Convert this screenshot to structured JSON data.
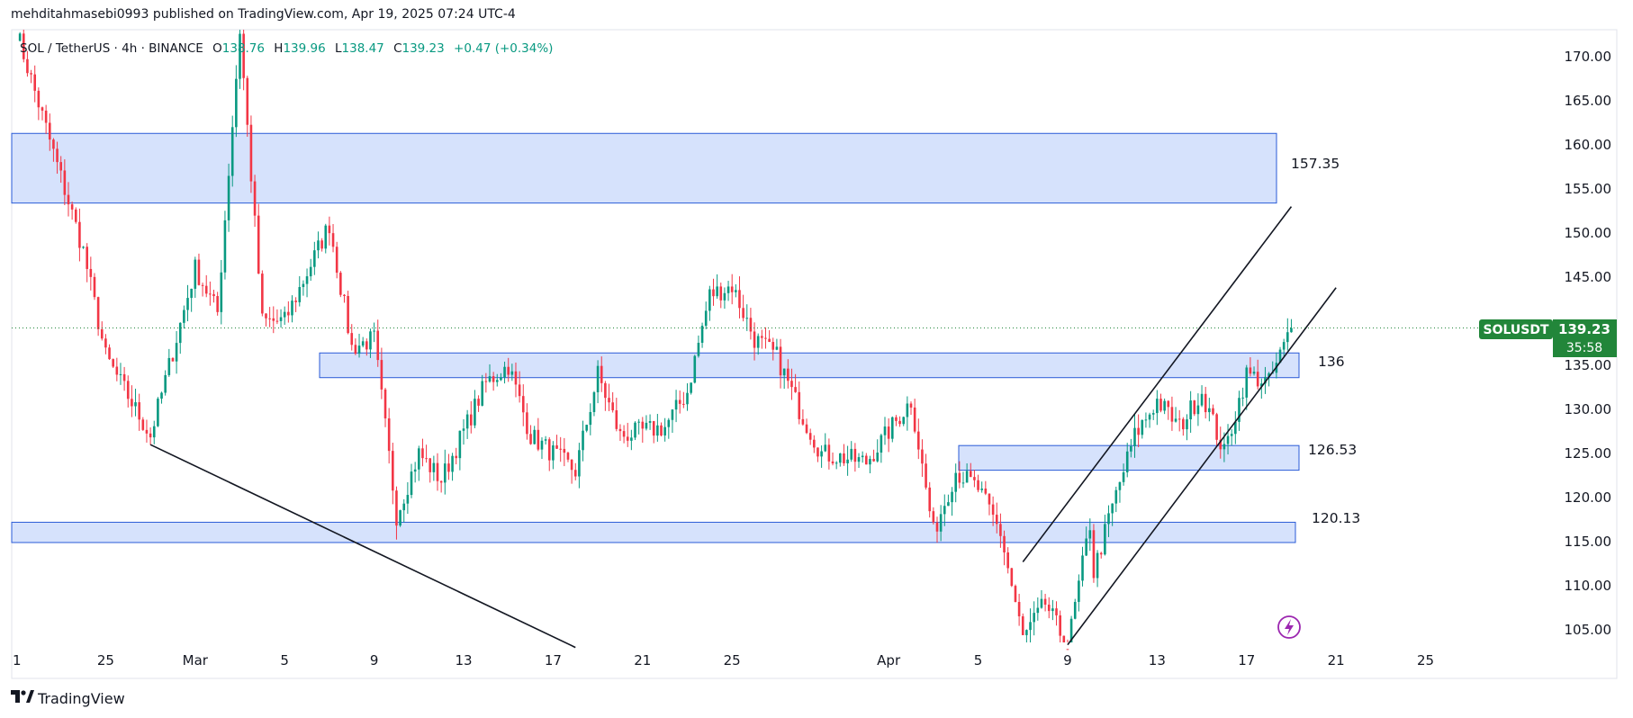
{
  "header": {
    "published_by": "mehditahmasebi0993 published on TradingView.com, Apr 19, 2025 07:24 UTC-4"
  },
  "footer": {
    "brand": "TradingView",
    "logo_icon": "tradingview-logo-icon"
  },
  "legend": {
    "symbol": "SOL / TetherUS · 4h · BINANCE",
    "open_label": "O",
    "open": "138.76",
    "high_label": "H",
    "high": "139.96",
    "low_label": "L",
    "low": "138.47",
    "close_label": "C",
    "close": "139.23",
    "change": "+0.47 (+0.34%)"
  },
  "price_badge": {
    "symbol": "SOLUSDT",
    "price": "139.23",
    "countdown": "35:58",
    "color": "#22863a"
  },
  "colors": {
    "up": "#089981",
    "down": "#f23645",
    "zone_fill": "#d6e2fc",
    "zone_stroke": "#2a5bd7",
    "line": "#131722",
    "badge": "#22863a"
  },
  "chart_data": {
    "type": "candlestick",
    "title": "",
    "x": [],
    "ylim": [
      102,
      173
    ],
    "yticks": [
      105,
      110,
      115,
      120,
      125,
      130,
      135,
      140,
      145,
      150,
      155,
      160,
      165,
      170
    ],
    "ytick_labels": [
      "105.00",
      "110.00",
      "115.00",
      "120.00",
      "125.00",
      "130.00",
      "135.00",
      "140.00",
      "145.00",
      "150.00",
      "155.00",
      "160.00",
      "165.00",
      "170.00"
    ],
    "xtick_labels": [
      "1",
      "25",
      "Mar",
      "5",
      "9",
      "13",
      "17",
      "21",
      "25",
      "Apr",
      "5",
      "9",
      "13",
      "17",
      "21",
      "25"
    ],
    "last_price": 139.23,
    "zones": [
      {
        "label": "157.35",
        "low": 153.4,
        "high": 161.3
      },
      {
        "label": "136",
        "low": 133.6,
        "high": 136.4
      },
      {
        "label": "126.53",
        "low": 123.1,
        "high": 125.9
      },
      {
        "label": "120.13",
        "low": 114.9,
        "high": 117.2
      }
    ],
    "anchors": [
      {
        "date": "Feb 21",
        "price": 173
      },
      {
        "date": "Feb 24",
        "price": 148
      },
      {
        "date": "Feb 25",
        "price": 136
      },
      {
        "date": "Feb 27",
        "price": 127
      },
      {
        "date": "Mar 1",
        "price": 146
      },
      {
        "date": "Mar 2",
        "price": 141
      },
      {
        "date": "Mar 3",
        "price": 173
      },
      {
        "date": "Mar 4",
        "price": 140
      },
      {
        "date": "Mar 5",
        "price": 140
      },
      {
        "date": "Mar 7",
        "price": 151
      },
      {
        "date": "Mar 8",
        "price": 137
      },
      {
        "date": "Mar 9",
        "price": 138
      },
      {
        "date": "Mar 10",
        "price": 118
      },
      {
        "date": "Mar 11",
        "price": 125
      },
      {
        "date": "Mar 12",
        "price": 122
      },
      {
        "date": "Mar 14",
        "price": 133
      },
      {
        "date": "Mar 15",
        "price": 135
      },
      {
        "date": "Mar 16",
        "price": 127
      },
      {
        "date": "Mar 18",
        "price": 123
      },
      {
        "date": "Mar 19",
        "price": 134
      },
      {
        "date": "Mar 20",
        "price": 127
      },
      {
        "date": "Mar 22",
        "price": 128
      },
      {
        "date": "Mar 23",
        "price": 132
      },
      {
        "date": "Mar 24",
        "price": 143
      },
      {
        "date": "Mar 25",
        "price": 144
      },
      {
        "date": "Mar 26",
        "price": 138
      },
      {
        "date": "Mar 27",
        "price": 136
      },
      {
        "date": "Mar 28",
        "price": 130
      },
      {
        "date": "Mar 29",
        "price": 125
      },
      {
        "date": "Mar 31",
        "price": 124
      },
      {
        "date": "Apr 2",
        "price": 131
      },
      {
        "date": "Apr 3",
        "price": 116
      },
      {
        "date": "Apr 4",
        "price": 123
      },
      {
        "date": "Apr 5",
        "price": 121
      },
      {
        "date": "Apr 6",
        "price": 116
      },
      {
        "date": "Apr 7",
        "price": 104
      },
      {
        "date": "Apr 8",
        "price": 108
      },
      {
        "date": "Apr 9",
        "price": 103
      },
      {
        "date": "Apr 10",
        "price": 117
      },
      {
        "date": "Apr 10",
        "price": 110
      },
      {
        "date": "Apr 11",
        "price": 119
      },
      {
        "date": "Apr 12",
        "price": 127
      },
      {
        "date": "Apr 13",
        "price": 131
      },
      {
        "date": "Apr 14",
        "price": 128
      },
      {
        "date": "Apr 15",
        "price": 132
      },
      {
        "date": "Apr 16",
        "price": 125
      },
      {
        "date": "Apr 17",
        "price": 134
      },
      {
        "date": "Apr 18",
        "price": 133
      },
      {
        "date": "Apr 19",
        "price": 139.23
      }
    ],
    "trendlines": [
      {
        "name": "descending",
        "from": {
          "date": "Feb 27",
          "price": 126
        },
        "to": {
          "date": "Mar 18",
          "price": 103
        }
      },
      {
        "name": "channel-upper",
        "from": {
          "date": "Apr 7",
          "price": 112.7
        },
        "to": {
          "date": "Apr 19",
          "price": 153
        }
      },
      {
        "name": "channel-lower",
        "from": {
          "date": "Apr 9",
          "price": 103.3
        },
        "to": {
          "date": "Apr 21",
          "price": 143.8
        }
      }
    ]
  }
}
